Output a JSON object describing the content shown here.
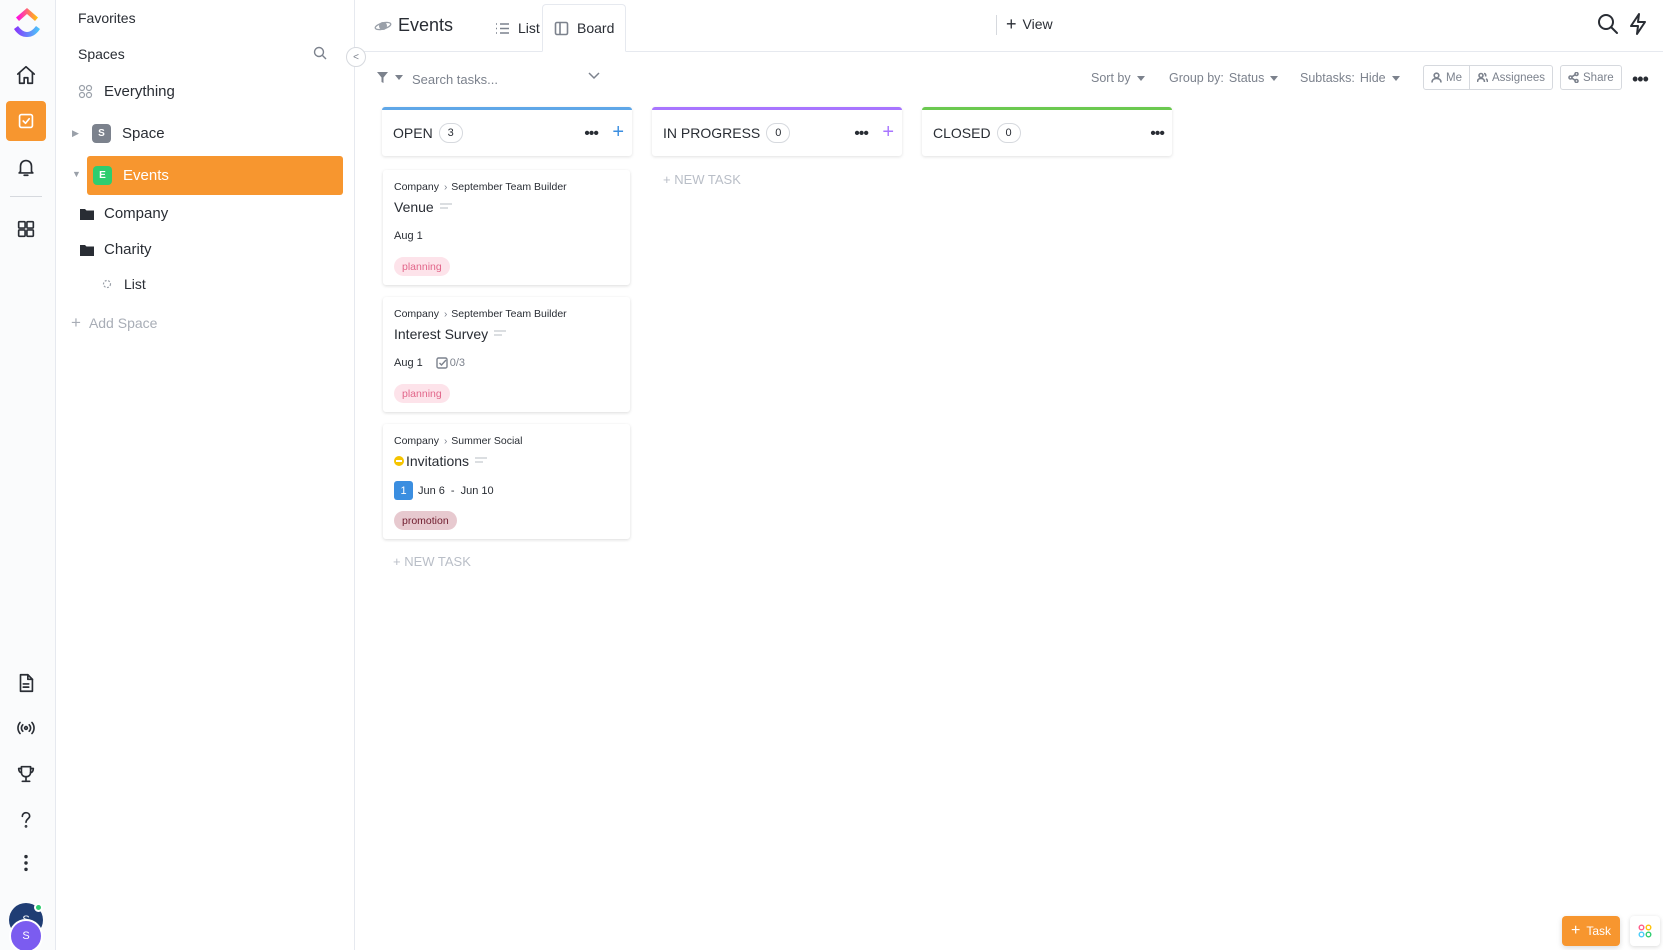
{
  "rail": {
    "icons": [
      "clickup-logo-icon",
      "home-icon",
      "tasks-icon",
      "bell-icon",
      "dashboard-icon",
      "docs-icon",
      "pulse-icon",
      "trophy-icon",
      "help-icon",
      "more-vertical-icon"
    ],
    "avatar1": "S",
    "avatar2": "S",
    "accent": "#f7962f"
  },
  "sidebar": {
    "favorites": "Favorites",
    "spaces": "Spaces",
    "everything": "Everything",
    "space": {
      "label": "Space",
      "badge": "S"
    },
    "events": {
      "label": "Events",
      "badge": "E"
    },
    "folders": [
      {
        "label": "Company"
      },
      {
        "label": "Charity"
      }
    ],
    "list": "List",
    "add_space": "Add Space"
  },
  "topbar": {
    "title": "Events",
    "tabs": [
      {
        "label": "List"
      },
      {
        "label": "Board"
      }
    ],
    "view": "View"
  },
  "toolbar": {
    "search_placeholder": "Search tasks...",
    "sort_by": "Sort by",
    "group_by_label": "Group by:",
    "group_by_value": "Status",
    "subtasks_label": "Subtasks:",
    "subtasks_value": "Hide",
    "me": "Me",
    "assignees": "Assignees",
    "share": "Share"
  },
  "board": {
    "columns": [
      {
        "name": "OPEN",
        "count": "3",
        "color": "#5fa7e8"
      },
      {
        "name": "IN PROGRESS",
        "count": "0",
        "color": "#a875ff"
      },
      {
        "name": "CLOSED",
        "count": "0",
        "color": "#6bc950"
      }
    ],
    "cards": [
      {
        "crumb_parent": "Company",
        "crumb_list": "September Team Builder",
        "name": "Venue",
        "date": "Aug 1",
        "tag": "planning"
      },
      {
        "crumb_parent": "Company",
        "crumb_list": "September Team Builder",
        "name": "Interest Survey",
        "date": "Aug 1",
        "checklist": "0/3",
        "tag": "planning"
      },
      {
        "crumb_parent": "Company",
        "crumb_list": "Summer Social",
        "name": "Invitations",
        "badge": "1",
        "start": "Jun 6",
        "sep": "-",
        "end": "Jun 10",
        "tag": "promotion"
      }
    ],
    "new_task": "+ NEW TASK"
  },
  "fab": {
    "label": "Task"
  }
}
